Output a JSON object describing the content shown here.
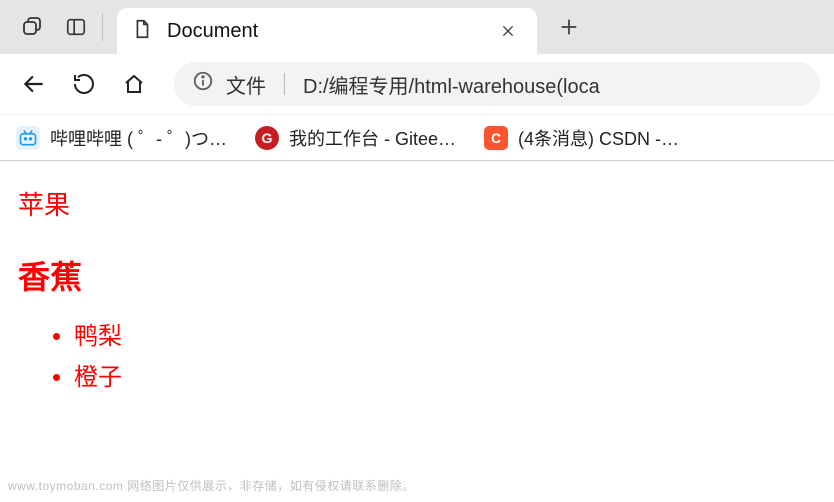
{
  "tab": {
    "title": "Document"
  },
  "addressbar": {
    "scheme_label": "文件",
    "url": "D:/编程专用/html-warehouse(loca"
  },
  "bookmarks": {
    "bili": "哔哩哔哩 ( ゜- ゜)つ…",
    "gitee": "我的工作台 - Gitee…",
    "csdn": "(4条消息) CSDN -…"
  },
  "page": {
    "p1": "苹果",
    "h2": "香蕉",
    "list": [
      "鸭梨",
      "橙子"
    ]
  },
  "watermark": "www.toymoban.com  网络图片仅供展示，非存储，如有侵权请联系删除。"
}
